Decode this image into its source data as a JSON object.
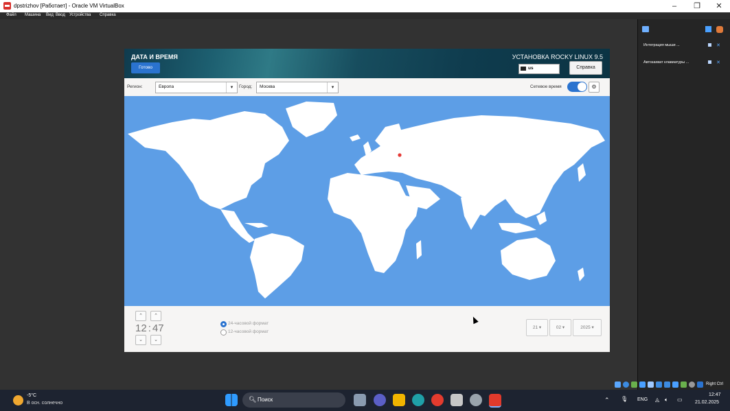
{
  "window": {
    "title": "dpstrizhov [Работает] - Oracle VM VirtualBox",
    "minimize_icon": "minimize-icon",
    "maximize_icon": "restore-icon",
    "close_icon": "close-icon"
  },
  "menu": [
    "Файл",
    "Машина",
    "Вид",
    "Ввод",
    "Устройства",
    "Справка"
  ],
  "installer": {
    "screen_title": "ДАТА И ВРЕМЯ",
    "done_button": "Готово",
    "product_title": "УСТАНОВКА ROCKY LINUX 9.5",
    "keyboard_layout": "us",
    "help_button": "Справка",
    "region_label": "Регион:",
    "region_value": "Европа",
    "city_label": "Город:",
    "city_value": "Москва",
    "network_time_label": "Сетевое время",
    "network_time_on": true,
    "time_hours": "12",
    "time_minutes": "47",
    "format_24": "24-часовой формат",
    "format_12": "12-часовой формат",
    "selected_format": "24",
    "day": "21",
    "month": "02",
    "year": "2025",
    "colors": {
      "accent": "#2a73cf",
      "ocean": "#5d9ee6",
      "land": "#ffffff",
      "marker": "#e53935"
    }
  },
  "right_panel": {
    "items": [
      {
        "label": "Интеграция мыши ..."
      },
      {
        "label": "Автозахват клавиатуры ..."
      }
    ],
    "host_key": "Right Ctrl"
  },
  "taskbar": {
    "weather_temp": "-5°C",
    "weather_desc": "В осн. солнечно",
    "search_placeholder": "Поиск",
    "language": "ENG",
    "time": "12:47",
    "date": "21.02.2025"
  }
}
